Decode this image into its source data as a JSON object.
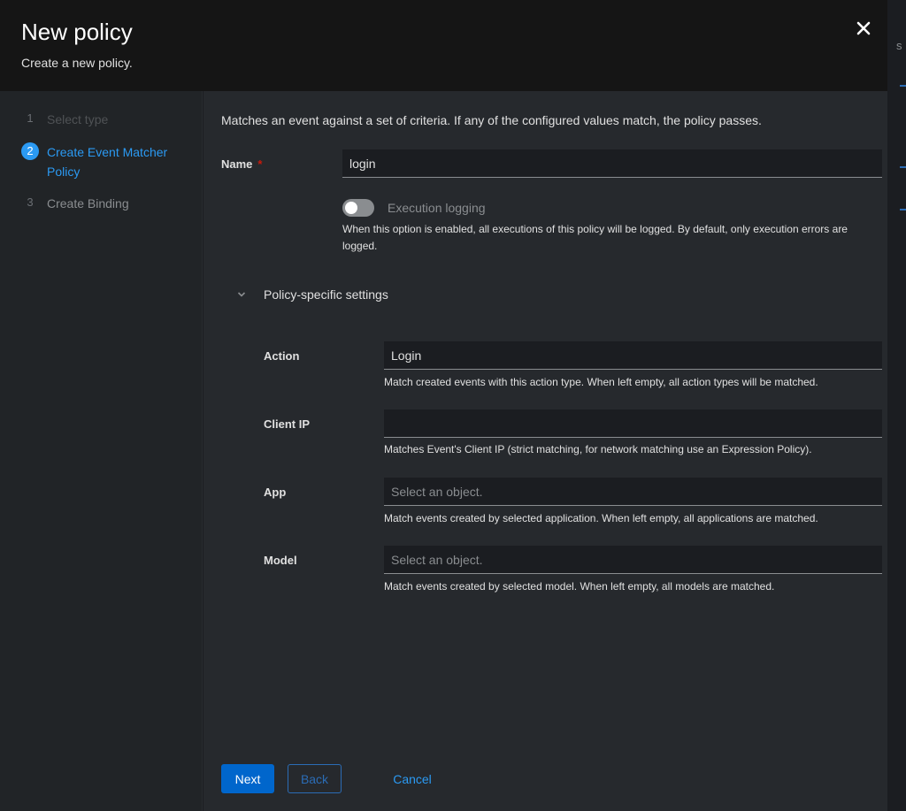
{
  "modal": {
    "title": "New policy",
    "subtitle": "Create a new policy.",
    "close_icon": "close-icon"
  },
  "background": {
    "partial_text": "s"
  },
  "wizard": {
    "steps": [
      {
        "number": "1",
        "label": "Select type",
        "state": "done"
      },
      {
        "number": "2",
        "label": "Create Event Matcher Policy",
        "state": "current"
      },
      {
        "number": "3",
        "label": "Create Binding",
        "state": "todo"
      }
    ]
  },
  "form": {
    "intro": "Matches an event against a set of criteria. If any of the configured values match, the policy passes.",
    "name": {
      "label": "Name",
      "required_mark": "*",
      "value": "login"
    },
    "execution_logging": {
      "label": "Execution logging",
      "enabled": false,
      "help": "When this option is enabled, all executions of this policy will be logged. By default, only execution errors are logged."
    },
    "section": {
      "label": "Policy-specific settings",
      "expanded": true,
      "icon": "chevron-down-icon"
    },
    "action": {
      "label": "Action",
      "value": "Login",
      "help": "Match created events with this action type. When left empty, all action types will be matched."
    },
    "client_ip": {
      "label": "Client IP",
      "value": "",
      "help": "Matches Event's Client IP (strict matching, for network matching use an Expression Policy)."
    },
    "app": {
      "label": "App",
      "placeholder": "Select an object.",
      "help": "Match events created by selected application. When left empty, all applications are matched."
    },
    "model": {
      "label": "Model",
      "placeholder": "Select an object.",
      "help": "Match events created by selected model. When left empty, all models are matched."
    }
  },
  "footer": {
    "next_label": "Next",
    "back_label": "Back",
    "cancel_label": "Cancel"
  },
  "colors": {
    "accent": "#0066cc",
    "link": "#2b9af3",
    "required": "#c9190b"
  }
}
